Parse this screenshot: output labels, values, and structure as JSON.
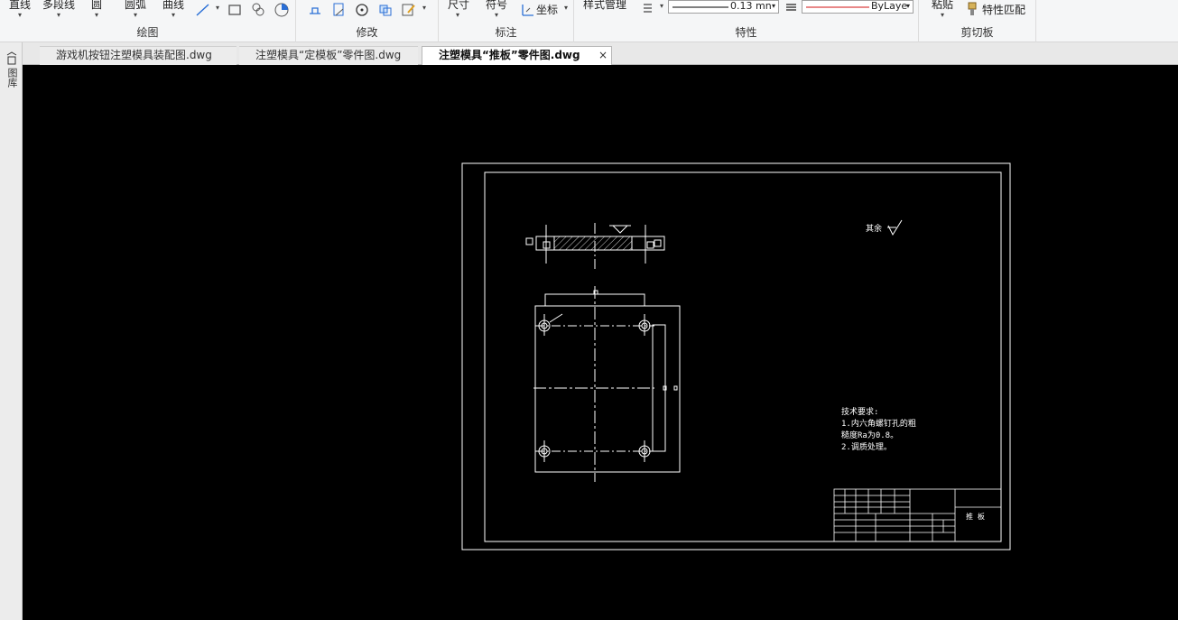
{
  "ribbon": {
    "draw": {
      "title": "绘图",
      "line": "直线",
      "polyline": "多段线",
      "circle": "圆",
      "arc": "圆弧",
      "curve": "曲线"
    },
    "modify": {
      "title": "修改"
    },
    "annotate": {
      "title": "标注",
      "dimension": "尺寸",
      "symbol": "符号",
      "coordinate": "坐标"
    },
    "properties": {
      "title": "特性",
      "style_manager": "样式管理",
      "lineweight": "0.13 mn",
      "color": "ByLaye"
    },
    "clipboard": {
      "title": "剪切板",
      "paste": "粘贴",
      "match_properties": "特性匹配"
    }
  },
  "tabs": [
    {
      "label": "游戏机按钮注塑模具装配图.dwg",
      "active": false
    },
    {
      "label": "注塑模具“定模板”零件图.dwg",
      "active": false
    },
    {
      "label": "注塑模具“推板”零件图.dwg",
      "active": true
    }
  ],
  "tab_close": "×",
  "left_strip": {
    "label": "图库"
  },
  "drawing": {
    "tech_requirements_title": "技术要求:",
    "tech_requirements": [
      "1.内六角螺钉孔的粗",
      "糙度Ra为0.8。",
      "2.调质处理。"
    ],
    "title_block_name": "推 板",
    "surface_finish_note": "其余"
  }
}
